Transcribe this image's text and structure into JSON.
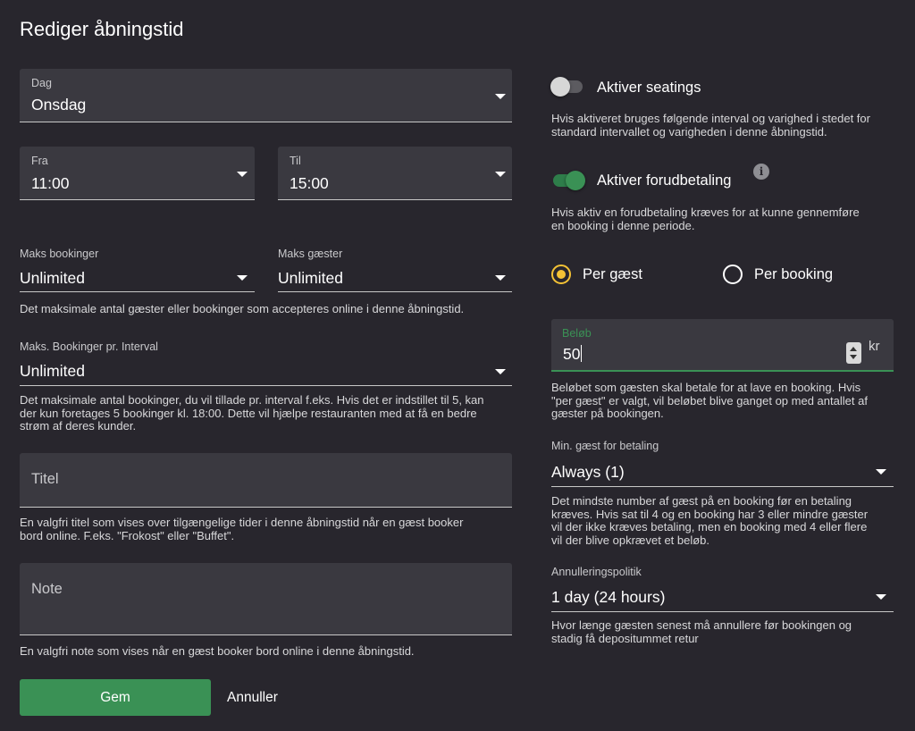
{
  "dialog": {
    "title": "Rediger åbningstid"
  },
  "left": {
    "day": {
      "label": "Dag",
      "value": "Onsdag"
    },
    "from": {
      "label": "Fra",
      "value": "11:00"
    },
    "to": {
      "label": "Til",
      "value": "15:00"
    },
    "max_bookings": {
      "label": "Maks bookinger",
      "value": "Unlimited"
    },
    "max_guests": {
      "label": "Maks gæster",
      "value": "Unlimited"
    },
    "max_help": "Det maksimale antal gæster eller bookinger som accepteres online i denne åbningstid.",
    "interval": {
      "label": "Maks. Bookinger pr. Interval",
      "value": "Unlimited"
    },
    "interval_help": [
      "Det maksimale antal bookinger, du vil tillade pr. interval f.eks. Hvis det er indstillet til 5, kan",
      "der kun foretages 5 bookinger kl. 18:00. Dette vil hjælpe restauranten med at få en bedre",
      "strøm af deres kunder."
    ],
    "title_field": {
      "placeholder": "Titel"
    },
    "title_help": [
      "En valgfri titel som vises over tilgængelige tider i denne åbningstid når en gæst booker",
      "bord online. F.eks. \"Frokost\" eller \"Buffet\"."
    ],
    "note_field": {
      "placeholder": "Note"
    },
    "note_help": "En valgfri note som vises når en gæst booker bord online i denne åbningstid."
  },
  "actions": {
    "save": "Gem",
    "cancel": "Annuller",
    "save_color": "#3a9155"
  },
  "right": {
    "seatings": {
      "label": "Aktiver seatings",
      "enabled": false,
      "help": [
        "Hvis aktiveret bruges følgende interval og varighed i stedet for",
        "standard intervallet og varigheden i denne åbningstid."
      ]
    },
    "prepayment": {
      "label": "Aktiver forudbetaling",
      "enabled": true,
      "info_icon": "info-icon",
      "help": [
        "Hvis aktiv en forudbetaling kræves for at kunne gennemføre",
        "en booking i denne periode."
      ]
    },
    "payment_mode": {
      "options": [
        "Per gæst",
        "Per booking"
      ],
      "selected": "Per gæst",
      "accent": "#f4c235"
    },
    "amount": {
      "label": "Beløb",
      "value": "50",
      "unit": "kr",
      "accent": "#3a9155",
      "help": [
        "Beløbet som gæsten skal betale for at lave en booking. Hvis",
        "\"per gæst\" er valgt, vil beløbet blive ganget op med antallet af",
        "gæster på bookingen."
      ]
    },
    "min_guests": {
      "label": "Min. gæst for betaling",
      "value": "Always (1)",
      "help": [
        "Det mindste number af gæst på en booking før en betaling",
        "kræves. Hvis sat til 4 og en booking har 3 eller mindre gæster",
        "vil der ikke kræves betaling, men en booking med 4 eller flere",
        "vil der blive opkrævet et beløb."
      ]
    },
    "cancellation": {
      "label": "Annulleringspolitik",
      "value": "1 day (24 hours)",
      "help": [
        "Hvor længe gæsten senest må annullere før bookingen og",
        "stadig få depositummet retur"
      ]
    }
  }
}
